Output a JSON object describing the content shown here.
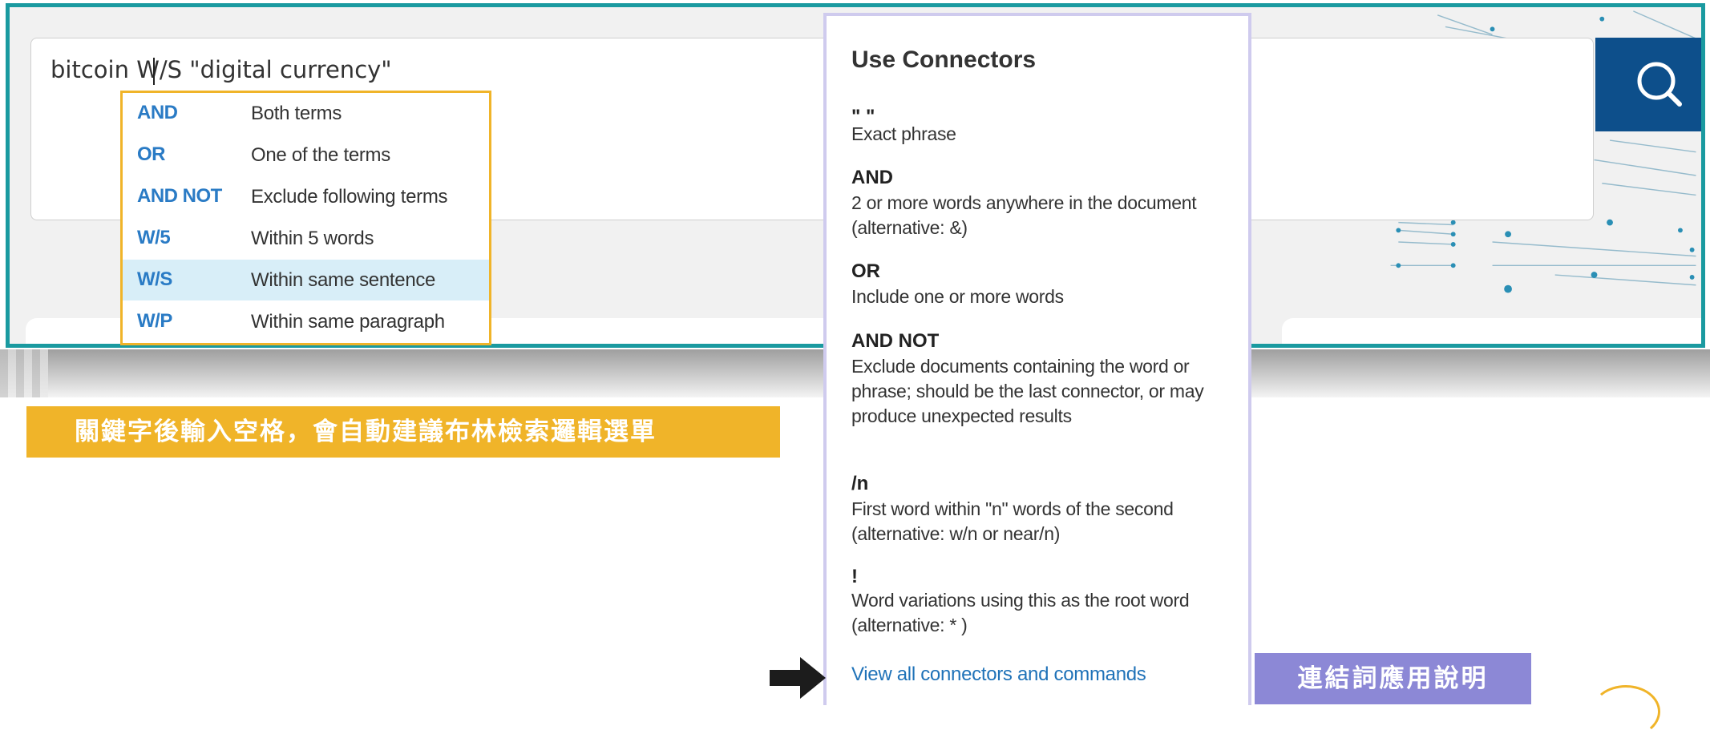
{
  "search": {
    "query_before_caret": "bitcoin ",
    "query_after_caret": "W/S \"digital currency\"",
    "button_icon": "search-icon"
  },
  "dropdown": {
    "items": [
      {
        "op": "AND",
        "desc": "Both terms",
        "selected": false
      },
      {
        "op": "OR",
        "desc": "One of the terms",
        "selected": false
      },
      {
        "op": "AND NOT",
        "desc": "Exclude following terms",
        "selected": false
      },
      {
        "op": "W/5",
        "desc": "Within 5 words",
        "selected": false
      },
      {
        "op": "W/S",
        "desc": "Within same sentence",
        "selected": true
      },
      {
        "op": "W/P",
        "desc": "Within same paragraph",
        "selected": false
      }
    ]
  },
  "help": {
    "title": "Use Connectors",
    "items": [
      {
        "term": "\" \"",
        "desc": "Exact phrase"
      },
      {
        "term": "AND",
        "desc": "2 or more words anywhere in the document (alternative: &)"
      },
      {
        "term": "OR",
        "desc": "Include one or more words"
      },
      {
        "term": "AND NOT",
        "desc": "Exclude documents containing the word or phrase; should be the last connector, or may produce unexpected results"
      },
      {
        "term": "/n",
        "desc": "First word within \"n\" words of the second (alternative: w/n or near/n)"
      },
      {
        "term": "!",
        "desc": "Word variations using this as the root word (alternative: * )"
      }
    ],
    "link": "View all connectors and commands"
  },
  "captions": {
    "orange": "關鍵字後輸入空格，會自動建議布林檢索邏輯選單",
    "purple": "連結詞應用說明"
  },
  "colors": {
    "frame": "#1a9aa0",
    "accent_orange": "#f0b429",
    "accent_purple": "#8c88d6",
    "search_button": "#0d4f8b",
    "link_blue": "#2a7bc5"
  }
}
